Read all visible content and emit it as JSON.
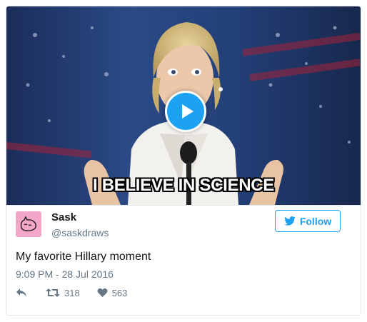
{
  "media": {
    "caption": "I BELIEVE IN SCIENCE",
    "play_color": "#1da1f2"
  },
  "user": {
    "name": "Sask",
    "handle": "@saskdraws",
    "avatar_color": "#f4a6c8"
  },
  "follow_button": {
    "label": "Follow",
    "icon": "twitter-bird-icon"
  },
  "tweet": {
    "text": "My favorite Hillary moment",
    "timestamp": "9:09 PM - 28 Jul 2016"
  },
  "actions": {
    "reply_icon": "reply-icon",
    "retweet_icon": "retweet-icon",
    "retweet_count": "318",
    "like_icon": "heart-icon",
    "like_count": "563"
  }
}
